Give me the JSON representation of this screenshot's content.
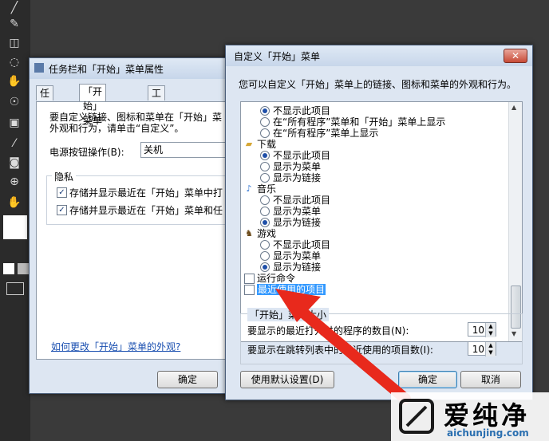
{
  "left_window": {
    "title": "任务栏和「开始」菜单属性",
    "tabs": [
      {
        "label": "任务栏"
      },
      {
        "label": "「开始」菜单"
      },
      {
        "label": "工具栏"
      }
    ],
    "description_line1": "要自定义链接、图标和菜单在「开始」菜",
    "description_line2": "外观和行为，请单击“自定义”。",
    "power_label": "电源按钮操作(B):",
    "power_value": "关机",
    "privacy_group": "隐私",
    "privacy_items": [
      {
        "label": "存储并显示最近在「开始」菜单中打",
        "checked": true
      },
      {
        "label": "存储并显示最近在「开始」菜单和任",
        "checked": true
      }
    ],
    "help_link": "如何更改「开始」菜单的外观?",
    "ok_button": "确定"
  },
  "right_window": {
    "title": "自定义「开始」菜单",
    "close_symbol": "✕",
    "intro": "您可以自定义「开始」菜单上的链接、图标和菜单的外观和行为。",
    "list_items": [
      {
        "type": "radio",
        "label": "不显示此项目",
        "checked": true
      },
      {
        "type": "radio",
        "label": "在“所有程序”菜单和「开始」菜单上显示",
        "checked": false
      },
      {
        "type": "radio",
        "label": "在“所有程序”菜单上显示",
        "checked": false
      },
      {
        "type": "header",
        "label": "下载",
        "icon": "folder-icon"
      },
      {
        "type": "radio",
        "label": "不显示此项目",
        "checked": true
      },
      {
        "type": "radio",
        "label": "显示为菜单",
        "checked": false
      },
      {
        "type": "radio",
        "label": "显示为链接",
        "checked": false
      },
      {
        "type": "header",
        "label": "音乐",
        "icon": "music-icon"
      },
      {
        "type": "radio",
        "label": "不显示此项目",
        "checked": false
      },
      {
        "type": "radio",
        "label": "显示为菜单",
        "checked": false
      },
      {
        "type": "radio",
        "label": "显示为链接",
        "checked": true
      },
      {
        "type": "header",
        "label": "游戏",
        "icon": "game-icon"
      },
      {
        "type": "radio",
        "label": "不显示此项目",
        "checked": false
      },
      {
        "type": "radio",
        "label": "显示为菜单",
        "checked": false
      },
      {
        "type": "radio",
        "label": "显示为链接",
        "checked": true
      },
      {
        "type": "check",
        "label": "运行命令",
        "checked": false
      },
      {
        "type": "check",
        "label": "最近使用的项目",
        "checked": false,
        "highlighted": true
      }
    ],
    "size_group": "「开始」菜单大小",
    "size_rows": [
      {
        "label": "要显示的最近打开过的程序的数目(N):",
        "value": "10"
      },
      {
        "label": "要显示在跳转列表中的最近使用的项目数(I):",
        "value": "10"
      }
    ],
    "defaults_button": "使用默认设置(D)",
    "ok_button": "确定",
    "cancel_button": "取消"
  },
  "watermark": {
    "title": "爱纯净",
    "url": "aichunjing.com"
  },
  "colors": {
    "arrow": "#e8291c",
    "highlight": "#3399ff",
    "link": "#1a4fb0"
  }
}
